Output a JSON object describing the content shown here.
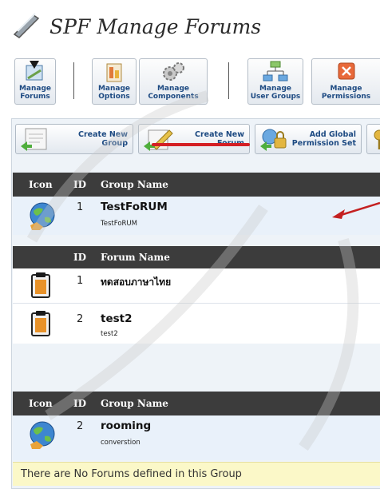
{
  "page": {
    "title": "SPF Manage Forums"
  },
  "toolbar": {
    "items": [
      {
        "line1": "Manage",
        "line2": "Forums"
      },
      {
        "line1": "Manage",
        "line2": "Options"
      },
      {
        "line1": "Manage",
        "line2": "Components"
      },
      {
        "line1": "Manage",
        "line2": "User Groups"
      },
      {
        "line1": "Manage",
        "line2": "Permissions"
      }
    ]
  },
  "actions": {
    "create_group": {
      "line1": "Create New",
      "line2": "Group"
    },
    "create_forum": {
      "line1": "Create New",
      "line2": "Forum"
    },
    "add_permission": {
      "line1": "Add Global",
      "line2": "Permission Set"
    }
  },
  "group_table": {
    "col_icon": "Icon",
    "col_id": "ID",
    "col_name": "Group Name"
  },
  "forum_table": {
    "col_id": "ID",
    "col_name": "Forum Name"
  },
  "groups": [
    {
      "id": "1",
      "name": "TestFoRUM",
      "description": "TestFoRUM",
      "forums": [
        {
          "id": "1",
          "name": "ทดสอบภาษาไทย",
          "description": ""
        },
        {
          "id": "2",
          "name": "test2",
          "description": "test2"
        }
      ]
    },
    {
      "id": "2",
      "name": "rooming",
      "description": "converstion"
    }
  ],
  "notice": "There are No Forums defined in this Group",
  "colors": {
    "header_bg": "#3c3c3c",
    "panel_bg": "#eef3f8",
    "notice_bg": "#fbf8c8",
    "accent_red": "#d41f24",
    "label_blue": "#1d4a82"
  }
}
